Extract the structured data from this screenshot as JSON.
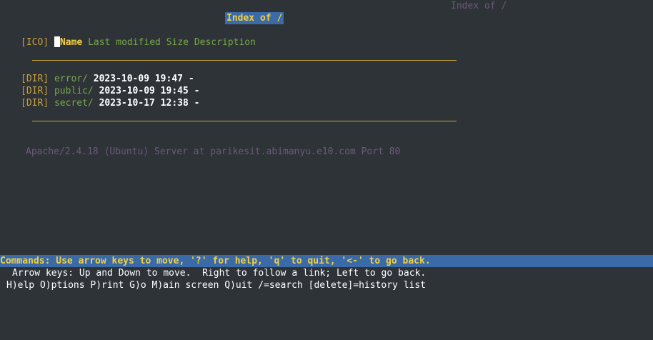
{
  "header": {
    "corner_title": "Index of /",
    "page_title": "Index of /"
  },
  "columns": {
    "icon": "[ICO]",
    "name": "Name",
    "last_modified": "Last modified",
    "size": "Size",
    "description": "Description"
  },
  "entries": [
    {
      "tag": "[DIR]",
      "name": "error/",
      "modified": "2023-10-09 19:47",
      "size": "-"
    },
    {
      "tag": "[DIR]",
      "name": "public/",
      "modified": "2023-10-09 19:45",
      "size": "-"
    },
    {
      "tag": "[DIR]",
      "name": "secret/",
      "modified": "2023-10-17 12:38",
      "size": "-"
    }
  ],
  "server_signature": "Apache/2.4.18 (Ubuntu) Server at parikesit.abimanyu.e10.com Port 80",
  "status": {
    "commands": "Commands: Use arrow keys to move, '?' for help, 'q' to quit, '<-' to go back.",
    "help_line1": "Arrow keys: Up and Down to move.  Right to follow a link; Left to go back.",
    "help_line2": "H)elp O)ptions P)rint G)o M)ain screen Q)uit /=search [delete]=history list"
  },
  "colors": {
    "background": "#2e3338",
    "highlight_bar": "#3a6aa8",
    "highlight_text": "#f4d03f",
    "link": "#7aa84a",
    "tag": "#c8a13a",
    "dim": "#6b5a7a"
  }
}
